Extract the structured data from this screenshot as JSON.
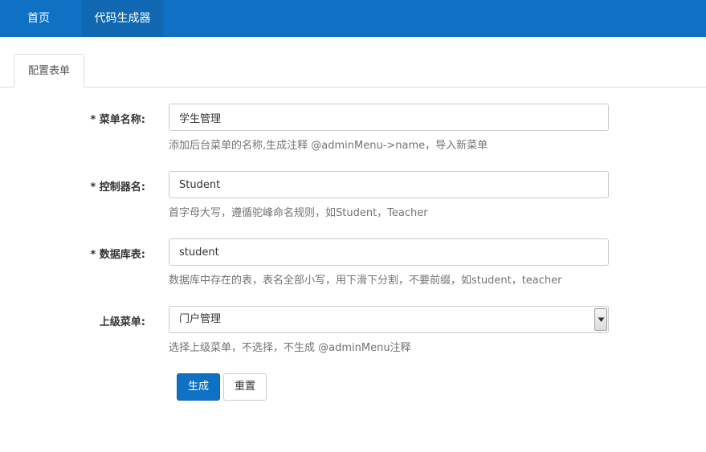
{
  "nav": {
    "items": [
      {
        "label": "首页"
      },
      {
        "label": "代码生成器"
      }
    ]
  },
  "tabs": [
    {
      "label": "配置表单"
    }
  ],
  "form": {
    "menu_name": {
      "label": "菜单名称:",
      "value": "学生管理",
      "help": "添加后台菜单的名称,生成注释 @adminMenu->name，导入新菜单"
    },
    "controller_name": {
      "label": "控制器名:",
      "value": "Student",
      "help": "首字母大写，遵循驼峰命名规则，如Student，Teacher"
    },
    "db_table": {
      "label": "数据库表:",
      "value": "student",
      "help": "数据库中存在的表，表名全部小写，用下滑下分割，不要前缀，如student，teacher"
    },
    "parent_menu": {
      "label": "上级菜单:",
      "value": "门户管理",
      "help": "选择上级菜单，不选择，不生成 @adminMenu注释"
    },
    "required_mark": "*",
    "submit_label": "生成",
    "reset_label": "重置"
  },
  "colors": {
    "nav_bg": "#0e71c4",
    "primary": "#0e71c4"
  }
}
